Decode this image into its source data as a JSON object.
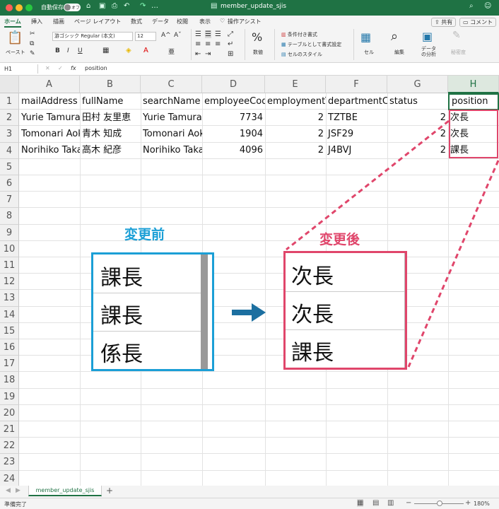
{
  "titlebar": {
    "autosave_label": "自動保存",
    "autosave_state": "オフ",
    "filename": "member_update_sjis"
  },
  "ribbon_tabs": [
    "ホーム",
    "挿入",
    "描画",
    "ページ レイアウト",
    "数式",
    "データ",
    "校閲",
    "表示"
  ],
  "tell_me": "操作アシスト",
  "share_label": "共有",
  "comment_label": "コメント",
  "ribbon": {
    "paste_label": "ペースト",
    "font_name": "游ゴシック Regular (本文)",
    "font_size": "12",
    "number_label": "数値",
    "cond_format": "条件付き書式",
    "table_format": "テーブルとして書式設定",
    "cell_styles": "セルのスタイル",
    "cells_label": "セル",
    "edit_label": "編集",
    "analyze_label": "データ\nの分析",
    "sensitivity_label": "秘密度"
  },
  "formula_bar": {
    "name_box": "H1",
    "fx": "fx",
    "formula": "position"
  },
  "columns": [
    "A",
    "B",
    "C",
    "D",
    "E",
    "F",
    "G",
    "H"
  ],
  "rows": [
    "1",
    "2",
    "3",
    "4",
    "5",
    "6",
    "7",
    "8",
    "9",
    "10",
    "11",
    "12",
    "13",
    "14",
    "15",
    "16",
    "17",
    "18",
    "19",
    "20",
    "21",
    "22",
    "23",
    "24"
  ],
  "cells": {
    "header": [
      "mailAddress",
      "fullName",
      "searchName",
      "employeeCode",
      "employmentType",
      "departmentCode",
      "status",
      "position"
    ],
    "row2": [
      "Yurie Tamura",
      "田村 友里恵",
      "Yurie Tamura",
      "7734",
      "2",
      "TZTBE",
      "2",
      "次長"
    ],
    "row3": [
      "Tomonari Aoki",
      "青木 知成",
      "Tomonari Aoki",
      "1904",
      "2",
      "JSF29",
      "2",
      "次長"
    ],
    "row4": [
      "Norihiko Takagi",
      "高木 紀彦",
      "Norihiko Takagi",
      "4096",
      "2",
      "J4BVJ",
      "2",
      "課長"
    ]
  },
  "annotation": {
    "before_label": "変更前",
    "after_label": "変更後",
    "before_values": [
      "課長",
      "課長",
      "係長"
    ],
    "after_values": [
      "次長",
      "次長",
      "課長"
    ],
    "before_color": "#1b9fd6",
    "after_color": "#e0466b",
    "arrow_color": "#1c6fa0"
  },
  "sheet_tab": "member_update_sjis",
  "status_text": "準備完了",
  "zoom": "180%",
  "colors": {
    "excel_green": "#1f7244"
  }
}
